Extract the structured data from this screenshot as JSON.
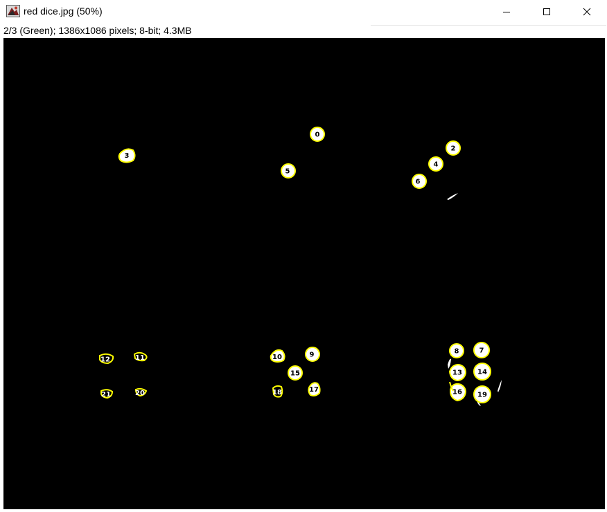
{
  "window": {
    "title": "red dice.jpg (50%)",
    "info": "2/3 (Green); 1386x1086 pixels; 8-bit; 4.3MB"
  },
  "icons": {
    "app": "imagej-app-icon",
    "minimize": "minimize-icon",
    "maximize": "maximize-icon",
    "close": "close-icon"
  },
  "colors": {
    "canvas_background": "#000000",
    "outline": "#ffff00",
    "blob": "#ffffff"
  },
  "particles": [
    {
      "label": "0"
    },
    {
      "label": "2"
    },
    {
      "label": "3"
    },
    {
      "label": "4"
    },
    {
      "label": "5"
    },
    {
      "label": "6"
    },
    {
      "label": "7"
    },
    {
      "label": "8"
    },
    {
      "label": "9"
    },
    {
      "label": "10"
    },
    {
      "label": "11"
    },
    {
      "label": "12"
    },
    {
      "label": "13"
    },
    {
      "label": "14"
    },
    {
      "label": "15"
    },
    {
      "label": "16"
    },
    {
      "label": "17"
    },
    {
      "label": "18"
    },
    {
      "label": "19"
    },
    {
      "label": "20"
    },
    {
      "label": "21"
    }
  ]
}
